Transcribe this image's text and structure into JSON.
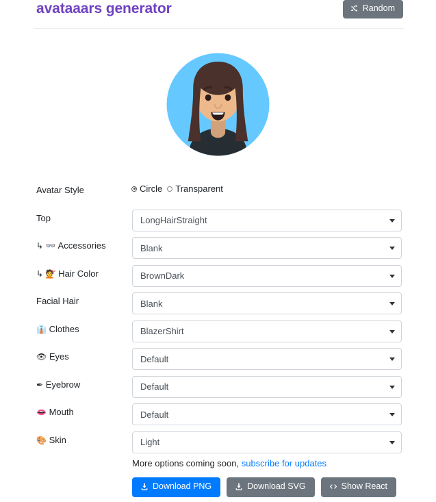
{
  "header": {
    "title": "avataaars generator",
    "random_button": {
      "label": "Random",
      "icon": "shuffle-icon"
    }
  },
  "avatar": {
    "style": "Circle",
    "background_color": "#65C9FF",
    "skin_color": "#EDB98A",
    "hair_color": "#4A312C",
    "clothes_color": "#262E33",
    "top": "LongHairStraight",
    "accessories": "Blank",
    "facial_hair": "Blank",
    "clothes": "BlazerShirt",
    "eyes": "Default",
    "eyebrow": "Default",
    "mouth": "Default"
  },
  "form": {
    "avatar_style": {
      "label": "Avatar Style",
      "options": [
        {
          "label": "Circle",
          "selected": true
        },
        {
          "label": "Transparent",
          "selected": false
        }
      ]
    },
    "fields": [
      {
        "label": "Top",
        "icon": "",
        "nested": false,
        "value": "LongHairStraight"
      },
      {
        "label": "Accessories",
        "icon": "👓",
        "nested": true,
        "value": "Blank"
      },
      {
        "label": "Hair Color",
        "icon": "💇",
        "nested": true,
        "value": "BrownDark"
      },
      {
        "label": "Facial Hair",
        "icon": "",
        "nested": false,
        "value": "Blank"
      },
      {
        "label": "Clothes",
        "icon": "👔",
        "nested": false,
        "value": "BlazerShirt"
      },
      {
        "label": "Eyes",
        "icon": "👁",
        "nested": false,
        "value": "Default"
      },
      {
        "label": "Eyebrow",
        "icon": "✒",
        "nested": false,
        "value": "Default"
      },
      {
        "label": "Mouth",
        "icon": "👄",
        "nested": false,
        "value": "Default"
      },
      {
        "label": "Skin",
        "icon": "🎨",
        "nested": false,
        "value": "Light"
      }
    ],
    "nested_prefix": "↳"
  },
  "footer": {
    "note_text": "More options coming soon,",
    "note_link": "subscribe for updates",
    "buttons": [
      {
        "label": "Download PNG",
        "icon": "download-icon",
        "style": "primary"
      },
      {
        "label": "Download SVG",
        "icon": "download-icon",
        "style": "secondary"
      },
      {
        "label": "Show React",
        "icon": "code-icon",
        "style": "secondary"
      }
    ]
  },
  "colors": {
    "title": "#6f42c1",
    "primary": "#007bff",
    "secondary": "#6c757d",
    "link": "#007bff"
  }
}
